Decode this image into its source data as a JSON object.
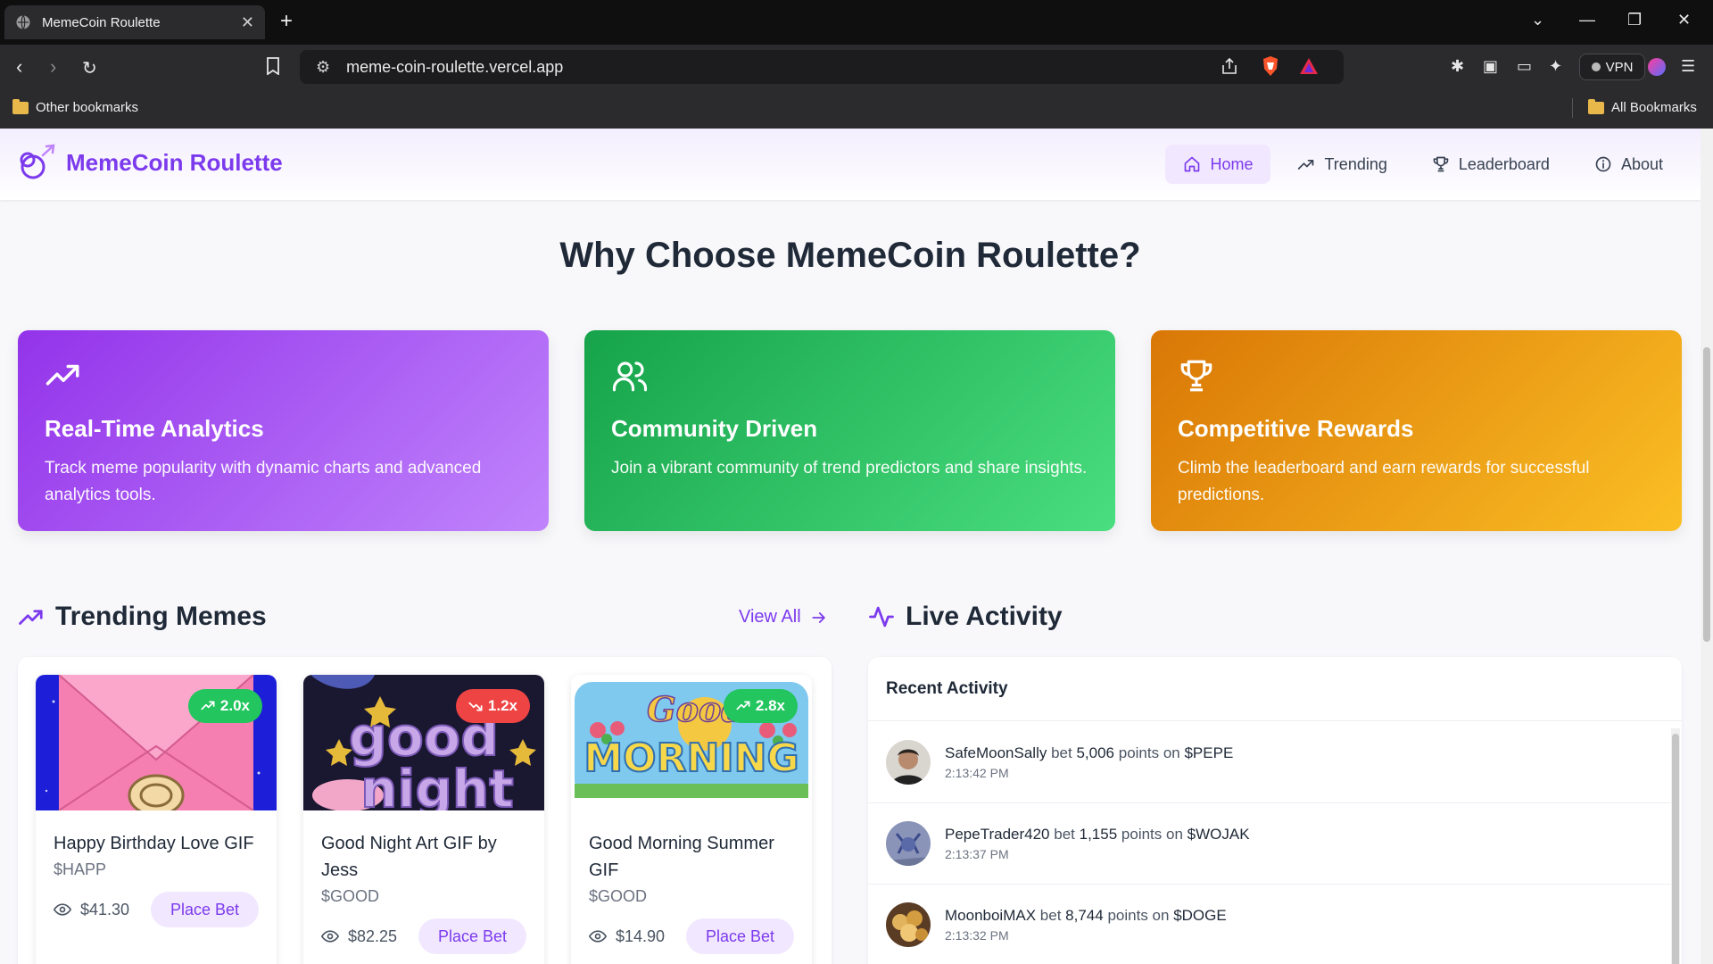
{
  "browser": {
    "tab_title": "MemeCoin Roulette",
    "url": "meme-coin-roulette.vercel.app",
    "vpn_label": "VPN",
    "bookmark_left": "Other bookmarks",
    "bookmark_right": "All Bookmarks"
  },
  "site": {
    "logo": "MemeCoin Roulette",
    "accent": "#7c3aed",
    "nav": [
      {
        "label": "Home",
        "icon": "home-icon",
        "active": true
      },
      {
        "label": "Trending",
        "icon": "trending-icon"
      },
      {
        "label": "Leaderboard",
        "icon": "trophy-icon"
      },
      {
        "label": "About",
        "icon": "info-icon"
      }
    ]
  },
  "why": {
    "title": "Why Choose MemeCoin Roulette?",
    "features": [
      {
        "title": "Real-Time Analytics",
        "desc": "Track meme popularity with dynamic charts and advanced analytics tools.",
        "icon": "trending-up-icon"
      },
      {
        "title": "Community Driven",
        "desc": "Join a vibrant community of trend predictors and share insights.",
        "icon": "users-icon"
      },
      {
        "title": "Competitive Rewards",
        "desc": "Climb the leaderboard and earn rewards for successful predictions.",
        "icon": "trophy-icon"
      }
    ]
  },
  "trending": {
    "title": "Trending Memes",
    "view_all": "View All",
    "cards": [
      {
        "title": "Happy Birthday Love GIF",
        "symbol": "$HAPP",
        "price": "$41.30",
        "multiplier": "2.0x",
        "trend": "up",
        "bet_label": "Place Bet"
      },
      {
        "title": "Good Night Art GIF by Jess",
        "symbol": "$GOOD",
        "price": "$82.25",
        "multiplier": "1.2x",
        "trend": "down",
        "bet_label": "Place Bet"
      },
      {
        "title": "Good Morning Summer GIF",
        "symbol": "$GOOD",
        "price": "$14.90",
        "multiplier": "2.8x",
        "trend": "up",
        "bet_label": "Place Bet"
      }
    ]
  },
  "activity": {
    "title": "Live Activity",
    "panel_title": "Recent Activity",
    "items": [
      {
        "user": "SafeMoonSally",
        "verb": "bet",
        "amount": "5,006",
        "mid": "points on",
        "coin": "$PEPE",
        "time": "2:13:42 PM"
      },
      {
        "user": "PepeTrader420",
        "verb": "bet",
        "amount": "1,155",
        "mid": "points on",
        "coin": "$WOJAK",
        "time": "2:13:37 PM"
      },
      {
        "user": "MoonboiMAX",
        "verb": "bet",
        "amount": "8,744",
        "mid": "points on",
        "coin": "$DOGE",
        "time": "2:13:32 PM"
      }
    ]
  }
}
